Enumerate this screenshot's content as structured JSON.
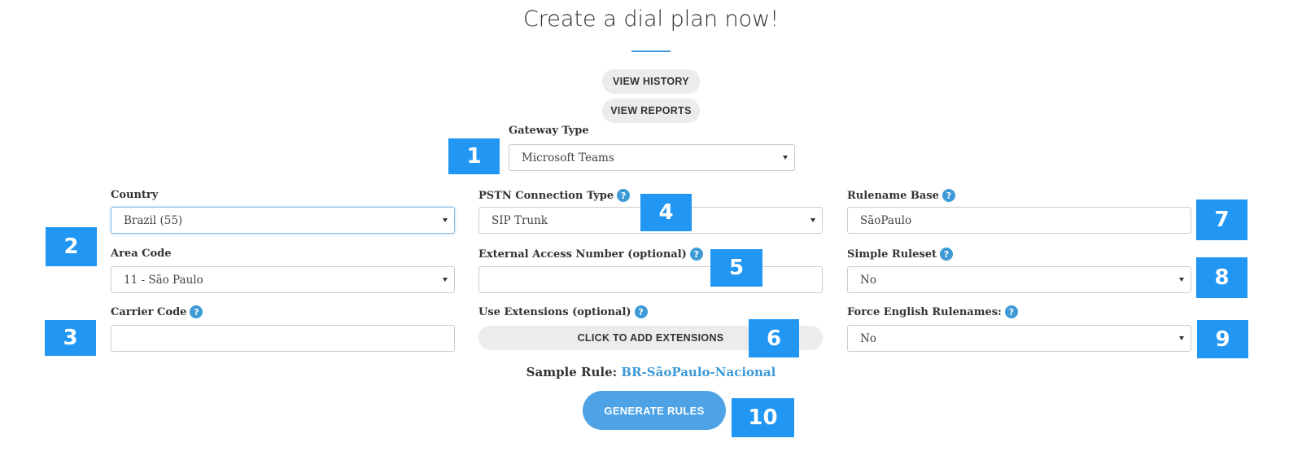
{
  "page": {
    "title": "Create a dial plan now!"
  },
  "buttons": {
    "view_history": "VIEW HISTORY",
    "view_reports": "VIEW REPORTS"
  },
  "gateway": {
    "label": "Gateway Type",
    "value": "Microsoft Teams"
  },
  "country": {
    "label": "Country",
    "value": "Brazil (55)"
  },
  "area_code": {
    "label": "Area Code",
    "value": "11 - São Paulo"
  },
  "carrier_code": {
    "label": "Carrier Code",
    "value": ""
  },
  "pstn": {
    "label": "PSTN Connection Type",
    "value": "SIP Trunk"
  },
  "external_access": {
    "label": "External Access Number (optional)",
    "value": ""
  },
  "extensions": {
    "label": "Use Extensions (optional)",
    "button": "CLICK TO ADD EXTENSIONS"
  },
  "rulename_base": {
    "label": "Rulename Base",
    "value": "SãoPaulo"
  },
  "simple_ruleset": {
    "label": "Simple Ruleset",
    "value": "No"
  },
  "force_english": {
    "label": "Force English Rulenames:",
    "value": "No"
  },
  "sample": {
    "label": "Sample Rule:",
    "value": "BR-SãoPaulo-Nacional"
  },
  "generate": {
    "label": "GENERATE RULES"
  },
  "help_icon": {
    "glyph": "?"
  },
  "badges": [
    "1",
    "2",
    "3",
    "4",
    "5",
    "6",
    "7",
    "8",
    "9",
    "10"
  ],
  "colors": {
    "accent": "#3d9ad6",
    "badge": "#2196f3",
    "generate_button": "#4da3e6",
    "pill_button": "#ececec"
  }
}
